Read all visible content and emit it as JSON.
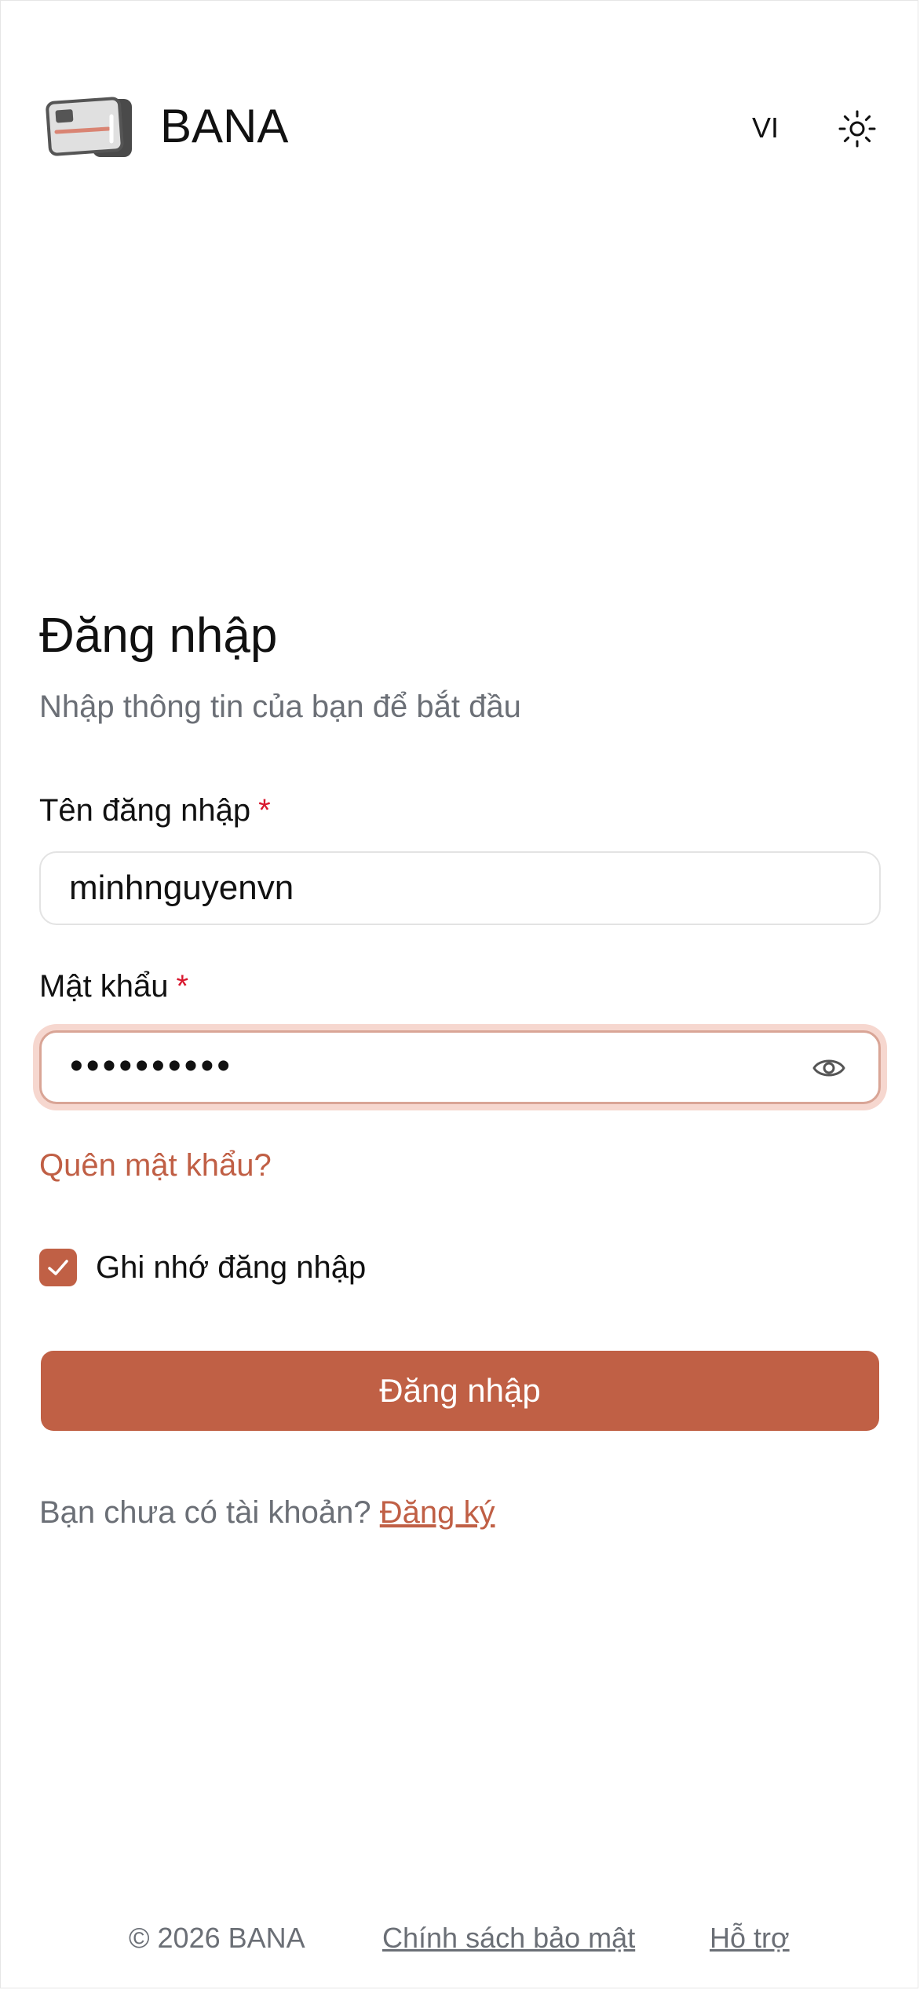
{
  "header": {
    "brand_name": "BANA",
    "language": "VI",
    "logo_icon": "card-icon",
    "theme_icon": "sun-icon"
  },
  "login": {
    "title": "Đăng nhập",
    "subtitle": "Nhập thông tin của bạn để bắt đầu",
    "username_label": "Tên đăng nhập",
    "username_value": "minhnguyenvn",
    "password_label": "Mật khẩu",
    "password_mask": "••••••••••",
    "required_mark": "*",
    "forgot_password": "Quên mật khẩu?",
    "remember_me": "Ghi nhớ đăng nhập",
    "remember_checked": true,
    "submit_label": "Đăng nhập",
    "no_account_text": "Bạn chưa có tài khoản?",
    "signup_link": "Đăng ký"
  },
  "footer": {
    "copyright": "© 2026 BANA",
    "privacy": "Chính sách bảo mật",
    "support": "Hỗ trợ"
  },
  "colors": {
    "accent": "#c06045",
    "required": "#d8172d",
    "muted_text": "#6b6f76",
    "focus_ring": "#f6d7cf"
  }
}
